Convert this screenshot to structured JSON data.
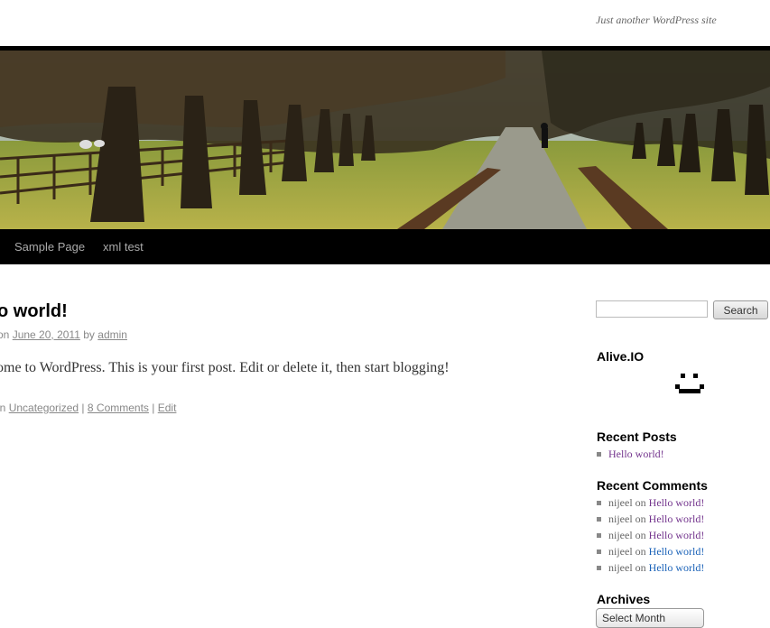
{
  "site": {
    "tagline": "Just another WordPress site"
  },
  "nav": {
    "items": [
      {
        "label": "Sample Page"
      },
      {
        "label": "xml test"
      }
    ]
  },
  "post": {
    "title": "o world!",
    "meta": {
      "prefix": "on",
      "date": "June 20, 2011",
      "by": "by",
      "author": "admin"
    },
    "content": "ome to WordPress. This is your first post. Edit or delete it, then start blogging!",
    "footer": {
      "prefix": "in",
      "category": "Uncategorized",
      "sep1": "|",
      "comments": "8 Comments",
      "sep2": "|",
      "edit": "Edit"
    }
  },
  "sidebar": {
    "search": {
      "placeholder": "",
      "button_label": "Search"
    },
    "widget_alive": {
      "title": "Alive.IO",
      "icon": "smiley-icon"
    },
    "recent_posts": {
      "title": "Recent Posts",
      "items": [
        {
          "label": "Hello world!"
        }
      ]
    },
    "recent_comments": {
      "title": "Recent Comments",
      "items": [
        {
          "author": "nijeel",
          "on": "on",
          "post": "Hello world!"
        },
        {
          "author": "nijeel",
          "on": "on",
          "post": "Hello world!"
        },
        {
          "author": "nijeel",
          "on": "on",
          "post": "Hello world!"
        },
        {
          "author": "nijeel",
          "on": "on",
          "post": "Hello world!"
        },
        {
          "author": "nijeel",
          "on": "on",
          "post": "Hello world!"
        }
      ]
    },
    "archives": {
      "title": "Archives",
      "select_label": "Select Month"
    }
  },
  "colors": {
    "visited_link": "#73348d",
    "link": "#1a62b8",
    "nav_bg": "#000000"
  }
}
